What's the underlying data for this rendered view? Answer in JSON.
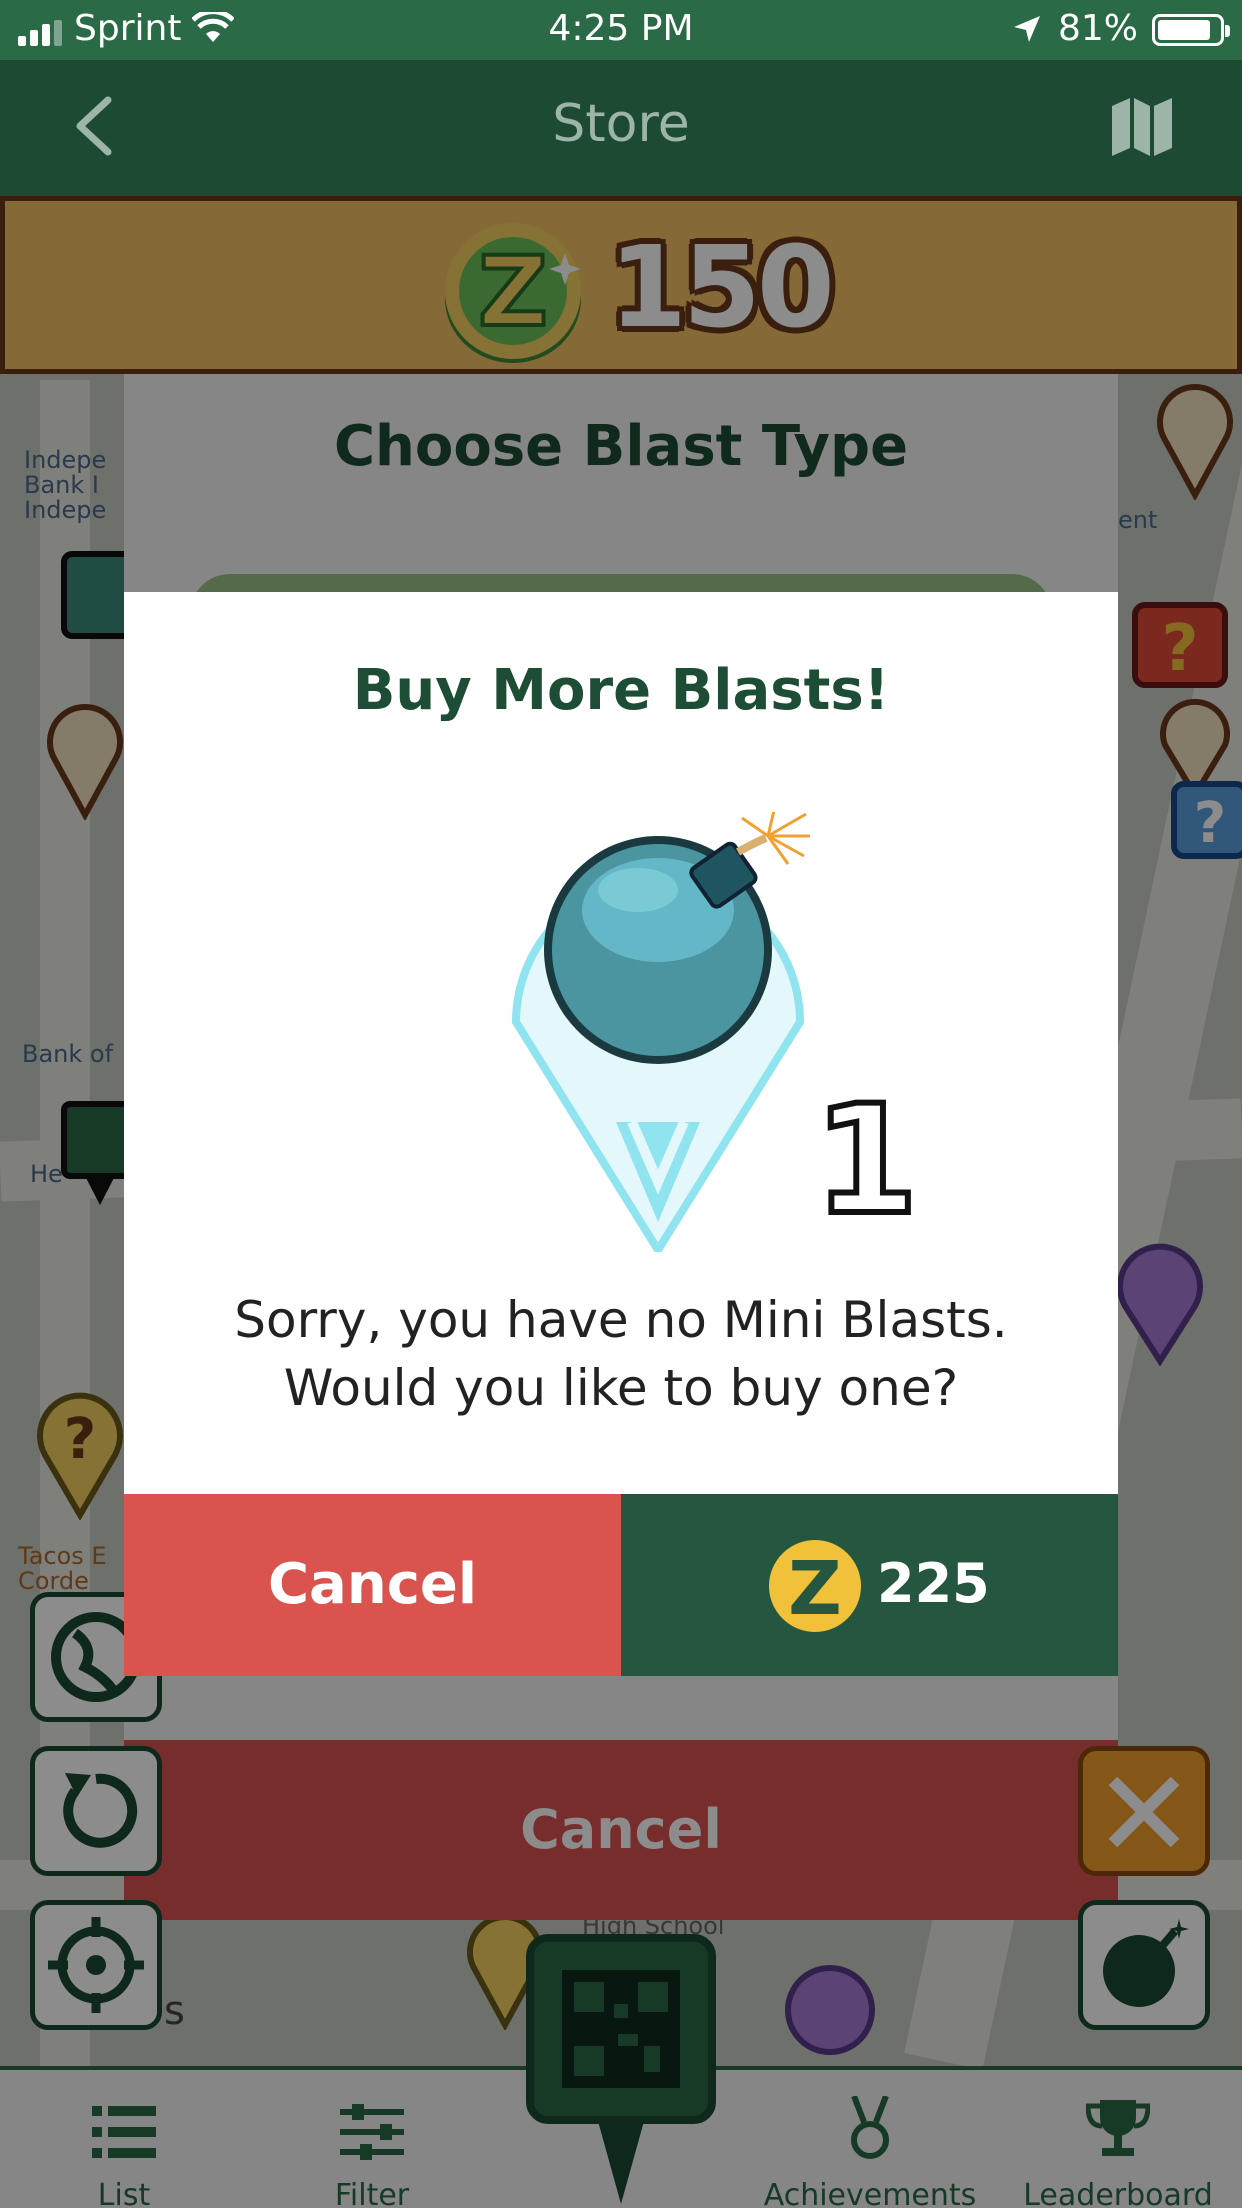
{
  "status_bar": {
    "carrier": "Sprint",
    "time": "4:25 PM",
    "battery_percent": "81%"
  },
  "nav": {
    "title": "Store"
  },
  "balance": {
    "amount": "150",
    "coin_symbol": "Z"
  },
  "blast_sheet": {
    "title": "Choose Blast Type",
    "cancel_label": "Cancel"
  },
  "map_labels": {
    "bank_partial": "Indepe\nBank I\nIndepe",
    "ent_partial": "ent",
    "bank_of": "Bank of",
    "he_partial": "He",
    "tacos": "Tacos E\nCorde",
    "high_school": "High School",
    "s_partial": "s"
  },
  "dialog": {
    "title": "Buy More Blasts!",
    "item_count": "1",
    "message_line1": "Sorry, you have no Mini Blasts.",
    "message_line2": "Would you like to buy one?",
    "cancel_label": "Cancel",
    "price": "225",
    "coin_symbol": "Z"
  },
  "tab_bar": {
    "items": [
      {
        "label": "List",
        "icon": "list-icon"
      },
      {
        "label": "Filter",
        "icon": "filter-icon"
      },
      {
        "label": "Achievements",
        "icon": "medal-icon"
      },
      {
        "label": "Leaderboard",
        "icon": "trophy-icon"
      }
    ]
  },
  "colors": {
    "status_green": "#2a6a47",
    "nav_green": "#1c4a33",
    "banner_orange": "#f2bf64",
    "cancel_red": "#d9534f",
    "buy_green": "#25563f",
    "title_green": "#1d4d35",
    "coin_yellow": "#f2c13a"
  }
}
